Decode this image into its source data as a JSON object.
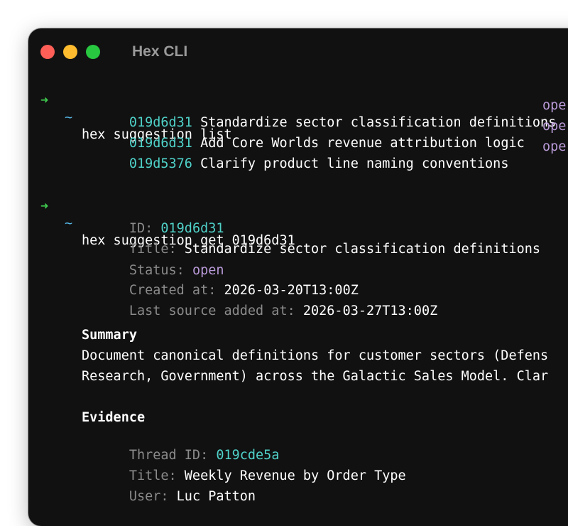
{
  "window": {
    "title": "Hex CLI"
  },
  "prompt": {
    "arrow": "➜",
    "cwd": "~"
  },
  "commands": {
    "list": "hex suggestion list",
    "get": "hex suggestion get 019d6d31"
  },
  "list_rows": [
    {
      "id": "019d6d31",
      "title": "Standardize sector classification definitions",
      "status": "ope"
    },
    {
      "id": "019d6d31",
      "title": "Add Core Worlds revenue attribution logic",
      "status": "ope"
    },
    {
      "id": "019d5376",
      "title": "Clarify product line naming conventions",
      "status": "ope"
    }
  ],
  "detail": {
    "id_label": "ID:",
    "id_value": "019d6d31",
    "title_label": "Title:",
    "title_value": "Standardize sector classification definitions",
    "status_label": "Status:",
    "status_value": "open",
    "created_label": "Created at:",
    "created_value": "2026-03-20T13:00Z",
    "source_label": "Last source added at:",
    "source_value": "2026-03-27T13:00Z"
  },
  "summary": {
    "heading": "Summary",
    "line1": "Document canonical definitions for customer sectors (Defens",
    "line2": "Research, Government) across the Galactic Sales Model. Clar"
  },
  "evidence": {
    "heading": "Evidence",
    "thread_label": "Thread ID:",
    "thread_value": "019cde5a",
    "title_label": "Title:",
    "title_value": "Weekly Revenue by Order Type",
    "user_label": "User:",
    "user_value": "Luc Patton"
  },
  "colors": {
    "background": "#111111",
    "prompt_arrow": "#3fcb4f",
    "prompt_tilde": "#56b8e8",
    "id_cyan": "#4fd1c8",
    "status_purple": "#b99ad8",
    "label_gray": "#8b8b8b"
  }
}
